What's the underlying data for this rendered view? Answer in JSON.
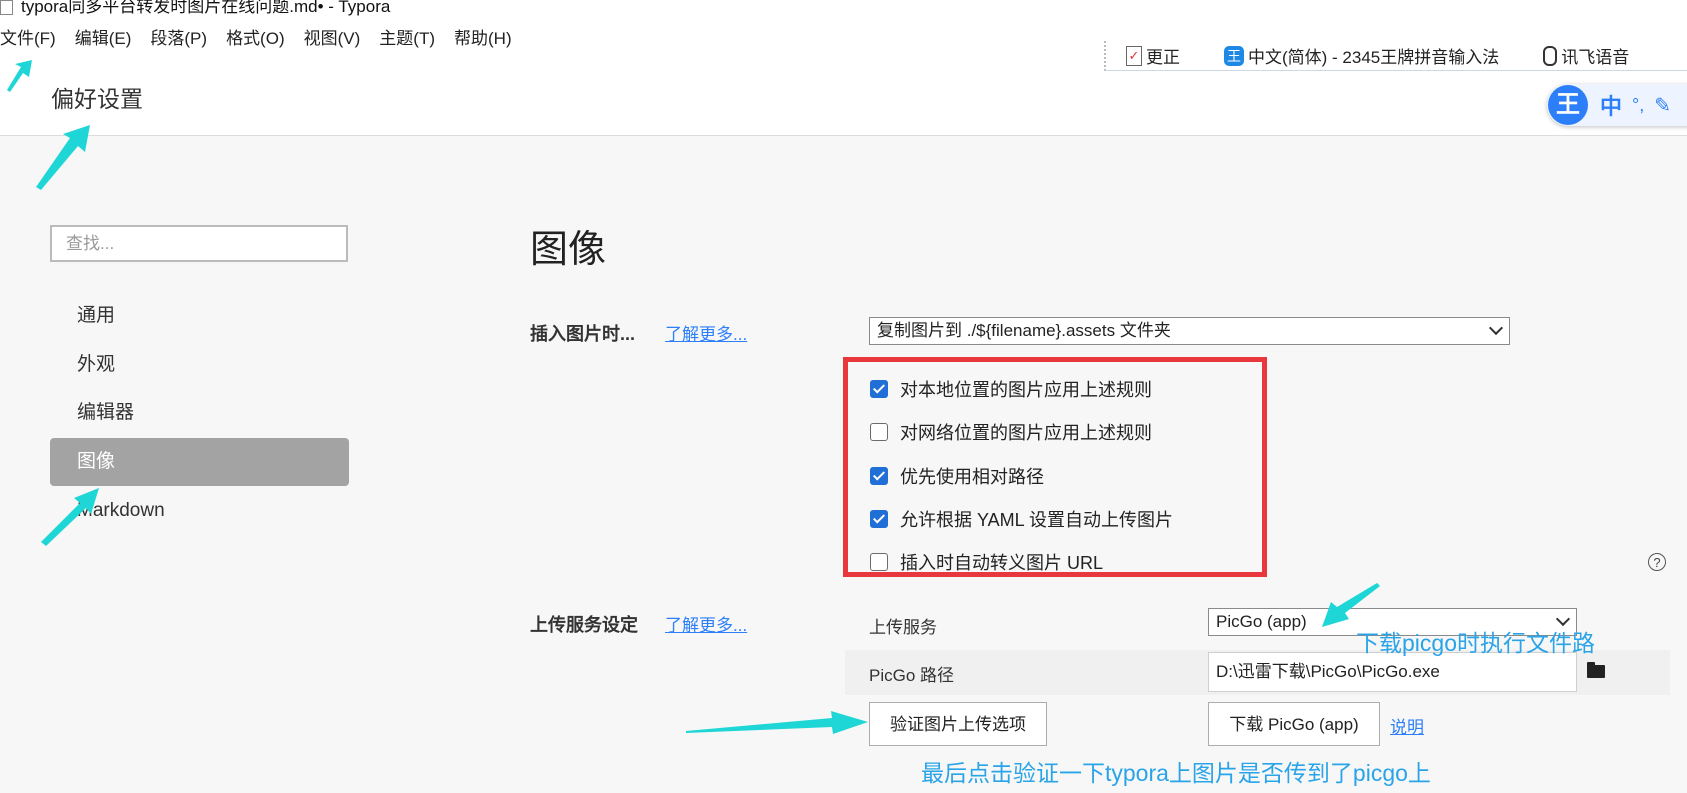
{
  "window": {
    "title": "typora同多平台转发时图片在线问题.md• - Typora"
  },
  "menu": [
    "文件(F)",
    "编辑(E)",
    "段落(P)",
    "格式(O)",
    "视图(V)",
    "主题(T)",
    "帮助(H)"
  ],
  "ime": {
    "fix_label": "更正",
    "fix_icon": "check-doc-icon",
    "input_method_label": "中文(简体) - 2345王牌拼音输入法",
    "input_method_icon": "wang-icon",
    "voice_label": "讯飞语音",
    "voice_icon": "microphone-icon",
    "float_logo": "王",
    "float_mode": "中",
    "float_punct": "°,",
    "float_pen_icon": "pen-icon"
  },
  "preferences": {
    "title": "偏好设置",
    "search_placeholder": "查找...",
    "nav": [
      {
        "label": "通用",
        "active": false
      },
      {
        "label": "外观",
        "active": false
      },
      {
        "label": "编辑器",
        "active": false
      },
      {
        "label": "图像",
        "active": true
      },
      {
        "label": "Markdown",
        "active": false
      }
    ]
  },
  "image_settings": {
    "title": "图像",
    "insert_label": "插入图片时...",
    "learn_more": "了解更多...",
    "insert_rule": "复制图片到 ./${filename}.assets 文件夹",
    "checkboxes": [
      {
        "label": "对本地位置的图片应用上述规则",
        "checked": true
      },
      {
        "label": "对网络位置的图片应用上述规则",
        "checked": false
      },
      {
        "label": "优先使用相对路径",
        "checked": true
      },
      {
        "label": "允许根据 YAML 设置自动上传图片",
        "checked": true
      },
      {
        "label": "插入时自动转义图片 URL",
        "checked": false
      }
    ],
    "highlight_color": "#e8383d",
    "help_icon": "question-circle-icon"
  },
  "upload_settings": {
    "label": "上传服务设定",
    "learn_more": "了解更多...",
    "service_label": "上传服务",
    "service_value": "PicGo (app)",
    "path_label": "PicGo 路径",
    "path_value": "D:\\迅雷下载\\PicGo\\PicGo.exe",
    "folder_icon": "folder-icon",
    "verify_button": "验证图片上传选项",
    "download_button": "下载 PicGo (app)",
    "help_link": "说明"
  },
  "annotations": {
    "picgo_path_note": "下载picgo时执行文件路",
    "verify_note": "最后点击验证一下typora上图片是否传到了picgo上",
    "color": "#2aa4e8",
    "arrow_color": "#1fd6d6"
  }
}
